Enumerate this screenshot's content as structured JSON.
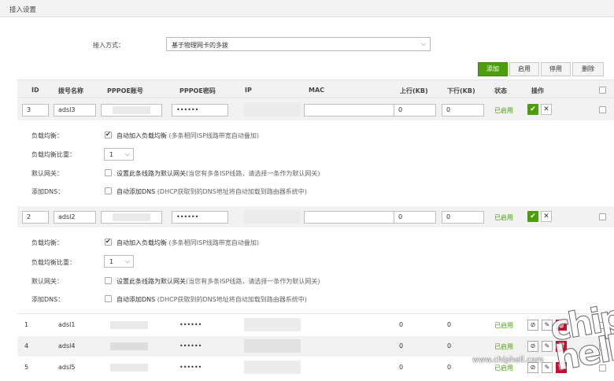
{
  "section_title": "接入设置",
  "mode": {
    "label": "接入方式：",
    "value": "基于物理网卡的多拨"
  },
  "toolbar": {
    "add": "添加",
    "enable": "启用",
    "disable": "停用",
    "delete": "删除"
  },
  "headers": {
    "id": "ID",
    "name": "拨号名称",
    "pppoe_user": "PPPOE账号",
    "pppoe_pass": "PPPOE密码",
    "ip": "IP",
    "mac": "MAC",
    "up": "上行(KB)",
    "down": "下行(KB)",
    "status": "状态",
    "ops": "操作"
  },
  "edit_rows": [
    {
      "id": "3",
      "name": "adsl3",
      "password": "••••••",
      "up": "0",
      "down": "0",
      "status": "已启用"
    },
    {
      "id": "2",
      "name": "adsl2",
      "password": "••••••",
      "up": "0",
      "down": "0",
      "status": "已启用"
    }
  ],
  "config": {
    "lb_label": "负载均衡：",
    "lb_text": "自动加入负载均衡",
    "lb_hint": "(多条相同ISP线路带宽自动叠加)",
    "weight_label": "负载均衡比重：",
    "weight_value": "1",
    "gw_label": "默认网关：",
    "gw_text": "设置此条线路为默认网关",
    "gw_hint": "(当您有多条ISP线路，请选择一条作为默认网关)",
    "dns_label": "添加DNS：",
    "dns_text": "自动添加DNS",
    "dns_hint": "(DHCP获取到的DNS地址将自动加载到路由器系统中)"
  },
  "rows": [
    {
      "id": "1",
      "name": "adsl1",
      "password": "••••••",
      "up": "0",
      "down": "0",
      "status": "已启用"
    },
    {
      "id": "4",
      "name": "adsl4",
      "password": "••••••",
      "up": "0",
      "down": "0",
      "status": "已启用"
    },
    {
      "id": "5",
      "name": "adsl5",
      "password": "••••••",
      "up": "0",
      "down": "0",
      "status": "已启用"
    }
  ],
  "watermark": {
    "url": "www.chiphell.com",
    "logo": "chip hell"
  },
  "colors": {
    "accent": "#4c9e0d",
    "danger": "#c8102e",
    "header_bg": "#f2f2f2"
  }
}
